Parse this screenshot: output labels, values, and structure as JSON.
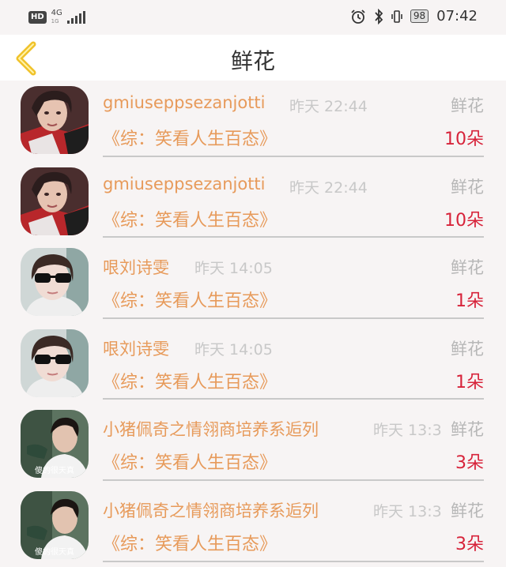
{
  "status_bar": {
    "hd": "HD",
    "network": "4G",
    "network_sub": "1G",
    "battery": "98",
    "time": "07:42"
  },
  "header": {
    "title": "鲜花",
    "back_icon": "chevron-left-icon",
    "accent_color": "#f0c22a"
  },
  "colors": {
    "username": "#e79a5a",
    "count": "#d7233a",
    "muted": "#c8c8c8"
  },
  "records": [
    {
      "user": "gmiuseppsezanjotti",
      "time": "昨天 22:44",
      "gift": "鲜花",
      "show": "《综：笑看人生百态》",
      "count": "10朵",
      "avatar": "avatar-a"
    },
    {
      "user": "gmiuseppsezanjotti",
      "time": "昨天 22:44",
      "gift": "鲜花",
      "show": "《综：笑看人生百态》",
      "count": "10朵",
      "avatar": "avatar-a"
    },
    {
      "user": "哏刘诗雯",
      "time": "昨天 14:05",
      "gift": "鲜花",
      "show": "《综：笑看人生百态》",
      "count": "1朵",
      "avatar": "avatar-b"
    },
    {
      "user": "哏刘诗雯",
      "time": "昨天 14:05",
      "gift": "鲜花",
      "show": "《综：笑看人生百态》",
      "count": "1朵",
      "avatar": "avatar-b"
    },
    {
      "user": "小猪佩奇之情翎商培养系逅列",
      "time": "昨天 13:3",
      "gift": "鲜花",
      "show": "《综：笑看人生百态》",
      "count": "3朵",
      "avatar": "avatar-c",
      "avatar_caption": "傻的很天真"
    },
    {
      "user": "小猪佩奇之情翎商培养系逅列",
      "time": "昨天 13:3",
      "gift": "鲜花",
      "show": "《综：笑看人生百态》",
      "count": "3朵",
      "avatar": "avatar-c",
      "avatar_caption": "傻的很天真"
    }
  ]
}
